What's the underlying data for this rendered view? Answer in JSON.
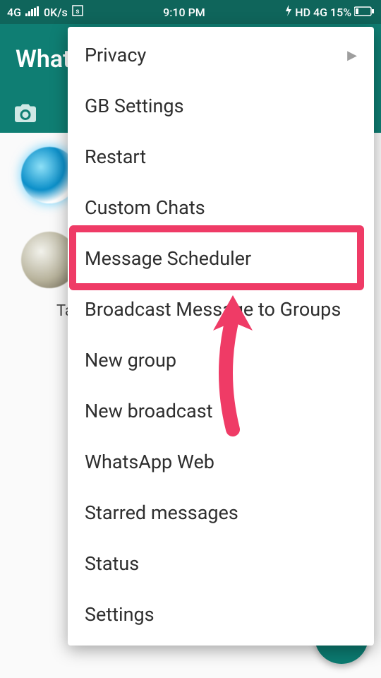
{
  "statusbar": {
    "net_type": "4G",
    "net_speed": "0K/s",
    "time": "9:10 PM",
    "hd": "HD",
    "net_right": "4G",
    "battery": "15%"
  },
  "appbar": {
    "title": "WhatsApp"
  },
  "background": {
    "partial_label": "Ta"
  },
  "menu": {
    "items": [
      "Privacy",
      "GB Settings",
      "Restart",
      "Custom Chats",
      "Message Scheduler",
      "Broadcast Message to Groups",
      "New group",
      "New broadcast",
      "WhatsApp Web",
      "Starred messages",
      "Status",
      "Settings"
    ]
  },
  "fab": {
    "glyph": "+"
  }
}
